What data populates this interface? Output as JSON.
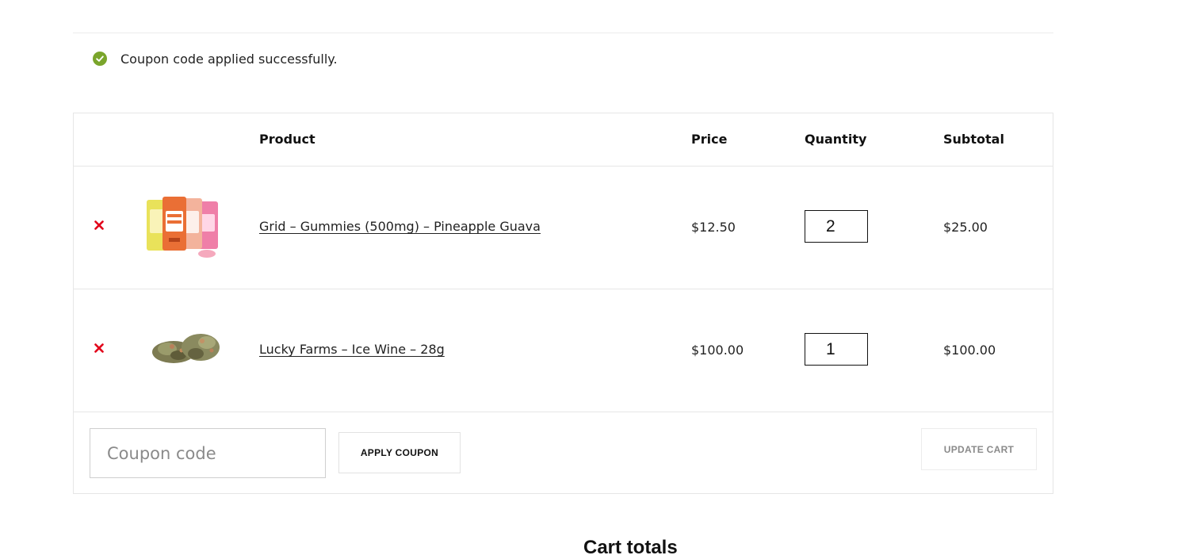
{
  "notice": {
    "message": "Coupon code applied successfully.",
    "icon": "check-circle-icon",
    "color": "#7aa52b"
  },
  "cart_table": {
    "headers": {
      "product": "Product",
      "price": "Price",
      "quantity": "Quantity",
      "subtotal": "Subtotal"
    },
    "items": [
      {
        "name": "Grid – Gummies (500mg) – Pineapple Guava",
        "price": "$12.50",
        "quantity": "2",
        "subtotal": "$25.00",
        "thumbnail": "gummies-pouches"
      },
      {
        "name": "Lucky Farms – Ice Wine – 28g",
        "price": "$100.00",
        "quantity": "1",
        "subtotal": "$100.00",
        "thumbnail": "cannabis-buds"
      }
    ],
    "remove_icon": "close-icon",
    "remove_color": "#e2001a"
  },
  "actions": {
    "coupon_placeholder": "Coupon code",
    "apply_label": "APPLY COUPON",
    "update_label": "UPDATE CART"
  },
  "totals": {
    "title": "Cart totals"
  }
}
